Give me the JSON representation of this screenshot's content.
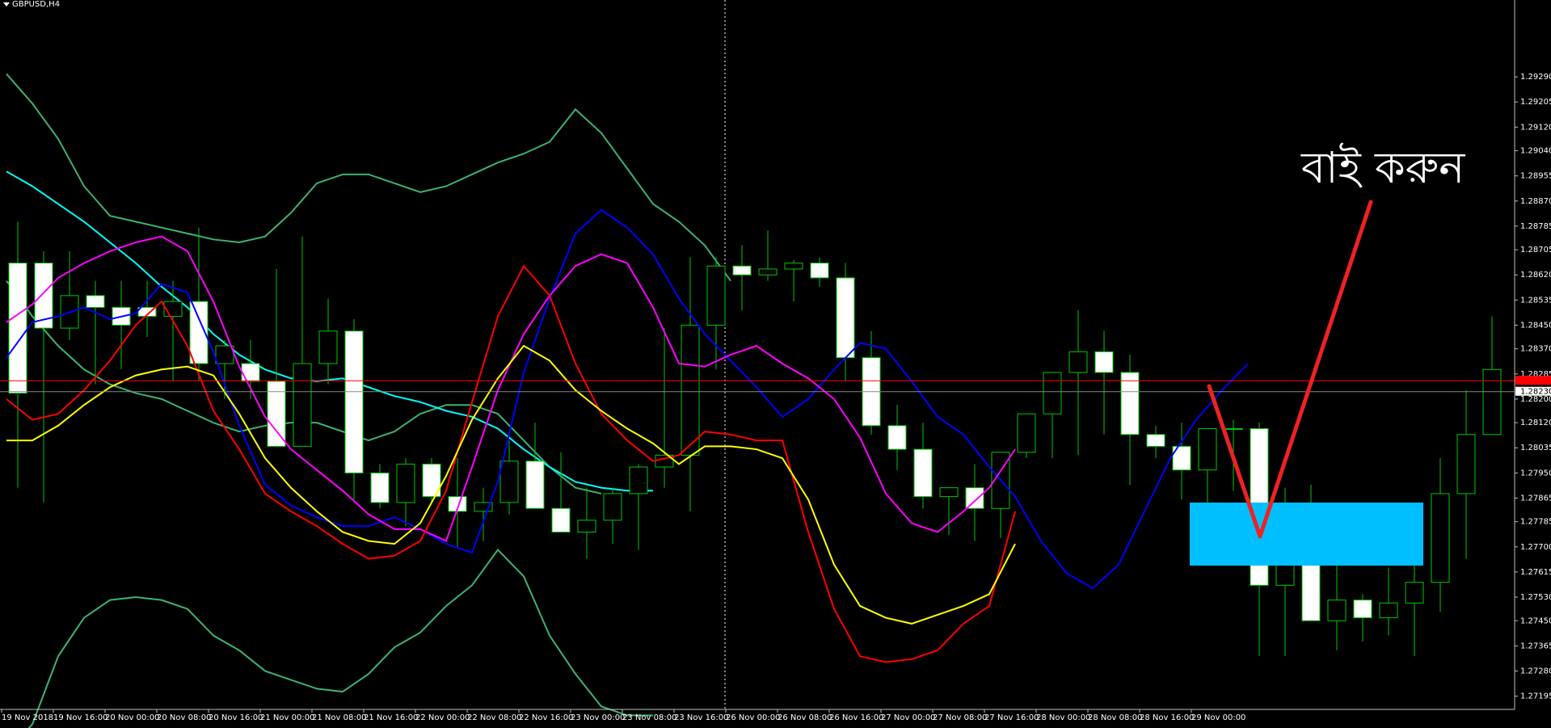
{
  "window": {
    "symbol": "GBPUSD,H4"
  },
  "annotation": {
    "text": "বাই করুন",
    "arrow_color": "#ee2222",
    "zone_color": "#00bfff"
  },
  "colors": {
    "background": "#000000",
    "candle_up": "#000000",
    "candle_down": "#ffffff",
    "candle_outline": "#00c800",
    "ma_blue": "#0000ff",
    "ma_magenta": "#ff00ff",
    "ma_red": "#ff0000",
    "ma_yellow": "#ffff00",
    "ma_cyan": "#00ffff",
    "bands": "#3cb371",
    "bid_line": "#ff0000",
    "bid_label_bg": "#ff0000",
    "current_label_bg": "#ffffff"
  },
  "chart_data": {
    "type": "candlestick",
    "symbol": "GBPUSD",
    "timeframe": "H4",
    "ylim": [
      1.2715,
      1.2955
    ],
    "price_ticks": [
      "1.29290",
      "1.29205",
      "1.29120",
      "1.29040",
      "1.28955",
      "1.28870",
      "1.28785",
      "1.28705",
      "1.28620",
      "1.28535",
      "1.28450",
      "1.28370",
      "1.28285",
      "1.28200",
      "1.28120",
      "1.28035",
      "1.27950",
      "1.27865",
      "1.27785",
      "1.27700",
      "1.27615",
      "1.27530",
      "1.27450",
      "1.27365",
      "1.27280",
      "1.27195"
    ],
    "current_price_label": "1.28230",
    "bid_line_price": 1.28262,
    "time_labels": [
      "19 Nov 2018",
      "19 Nov 16:00",
      "20 Nov 00:00",
      "20 Nov 08:00",
      "20 Nov 16:00",
      "21 Nov 00:00",
      "21 Nov 08:00",
      "21 Nov 16:00",
      "22 Nov 00:00",
      "22 Nov 08:00",
      "22 Nov 16:00",
      "23 Nov 00:00",
      "23 Nov 08:00",
      "23 Nov 16:00",
      "26 Nov 00:00",
      "26 Nov 08:00",
      "26 Nov 16:00",
      "27 Nov 00:00",
      "27 Nov 08:00",
      "27 Nov 16:00",
      "28 Nov 00:00",
      "28 Nov 08:00",
      "28 Nov 16:00",
      "29 Nov 00:00"
    ],
    "candles": [
      [
        1.2866,
        1.288,
        1.279,
        1.2822
      ],
      [
        1.2866,
        1.287,
        1.2785,
        1.2844
      ],
      [
        1.2844,
        1.287,
        1.284,
        1.2855
      ],
      [
        1.2855,
        1.286,
        1.2825,
        1.2851
      ],
      [
        1.2851,
        1.286,
        1.283,
        1.2845
      ],
      [
        1.2851,
        1.286,
        1.2841,
        1.2848
      ],
      [
        1.2848,
        1.286,
        1.2826,
        1.2853
      ],
      [
        1.2853,
        1.2878,
        1.2826,
        1.2832
      ],
      [
        1.2832,
        1.284,
        1.282,
        1.2838
      ],
      [
        1.2832,
        1.284,
        1.282,
        1.2826
      ],
      [
        1.2826,
        1.2864,
        1.2819,
        1.2804
      ],
      [
        1.2804,
        1.2875,
        1.2825,
        1.2832
      ],
      [
        1.2832,
        1.2854,
        1.2825,
        1.2843
      ],
      [
        1.2843,
        1.2847,
        1.2785,
        1.2795
      ],
      [
        1.2795,
        1.2798,
        1.2783,
        1.2785
      ],
      [
        1.2785,
        1.28,
        1.2777,
        1.2798
      ],
      [
        1.2798,
        1.28,
        1.2785,
        1.2787
      ],
      [
        1.2787,
        1.28,
        1.277,
        1.2782
      ],
      [
        1.2782,
        1.279,
        1.2772,
        1.2785
      ],
      [
        1.2785,
        1.2806,
        1.2781,
        1.2799
      ],
      [
        1.2799,
        1.2812,
        1.2793,
        1.2783
      ],
      [
        1.2783,
        1.2802,
        1.278,
        1.2775
      ],
      [
        1.2775,
        1.279,
        1.2766,
        1.2779
      ],
      [
        1.2779,
        1.279,
        1.2771,
        1.2788
      ],
      [
        1.2788,
        1.2798,
        1.2769,
        1.2797
      ],
      [
        1.2797,
        1.2844,
        1.279,
        1.2801
      ],
      [
        1.2801,
        1.2868,
        1.2782,
        1.2845
      ],
      [
        1.2845,
        1.2868,
        1.283,
        1.2865
      ],
      [
        1.2865,
        1.2872,
        1.285,
        1.2862
      ],
      [
        1.2862,
        1.2877,
        1.286,
        1.2864
      ],
      [
        1.2864,
        1.2867,
        1.2853,
        1.2866
      ],
      [
        1.2866,
        1.2868,
        1.2858,
        1.2861
      ],
      [
        1.2861,
        1.2866,
        1.2826,
        1.2834
      ],
      [
        1.2834,
        1.2843,
        1.2808,
        1.2811
      ],
      [
        1.2811,
        1.2818,
        1.2796,
        1.2803
      ],
      [
        1.2803,
        1.2812,
        1.2783,
        1.2787
      ],
      [
        1.2787,
        1.279,
        1.2774,
        1.279
      ],
      [
        1.279,
        1.2798,
        1.2772,
        1.2783
      ],
      [
        1.2783,
        1.2787,
        1.2773,
        1.2802
      ],
      [
        1.2802,
        1.2808,
        1.28,
        1.2815
      ],
      [
        1.2815,
        1.2826,
        1.28,
        1.2829
      ],
      [
        1.2829,
        1.285,
        1.2801,
        1.2836
      ],
      [
        1.2836,
        1.2843,
        1.2808,
        1.2829
      ],
      [
        1.2829,
        1.2835,
        1.2791,
        1.2808
      ],
      [
        1.2808,
        1.2811,
        1.28,
        1.2804
      ],
      [
        1.2804,
        1.2812,
        1.2786,
        1.2796
      ],
      [
        1.2796,
        1.2809,
        1.2785,
        1.281
      ],
      [
        1.281,
        1.2813,
        1.2789,
        1.281
      ],
      [
        1.281,
        1.2812,
        1.2733,
        1.2757
      ],
      [
        1.2757,
        1.279,
        1.2733,
        1.2781
      ],
      [
        1.2781,
        1.2791,
        1.2756,
        1.2745
      ],
      [
        1.2745,
        1.2766,
        1.2735,
        1.2752
      ],
      [
        1.2752,
        1.2754,
        1.2738,
        1.2746
      ],
      [
        1.2746,
        1.2763,
        1.274,
        1.2751
      ],
      [
        1.2751,
        1.2768,
        1.2733,
        1.2758
      ],
      [
        1.2758,
        1.28,
        1.2748,
        1.2788
      ],
      [
        1.2788,
        1.2823,
        1.2766,
        1.2808
      ],
      [
        1.2808,
        1.2848,
        1.2808,
        1.283
      ],
      [
        1.283,
        1.2845,
        1.2808,
        1.2836
      ],
      [
        1.2836,
        1.2841,
        1.2819,
        1.2832
      ]
    ],
    "ma_blue": [
      1.2834,
      1.2846,
      1.2848,
      1.2851,
      1.2847,
      1.2849,
      1.2859,
      1.2856,
      1.2836,
      1.2811,
      1.2791,
      1.2784,
      1.278,
      1.2777,
      1.2777,
      1.278,
      1.2776,
      1.2771,
      1.2768,
      1.2792,
      1.2829,
      1.2854,
      1.2876,
      1.2884,
      1.2878,
      1.2869,
      1.2854,
      1.2842,
      1.2833,
      1.2824,
      1.2814,
      1.282,
      1.283,
      1.2839,
      1.2837,
      1.2826,
      1.2814,
      1.2808,
      1.2797,
      1.2787,
      1.2772,
      1.2761,
      1.2756,
      1.2764,
      1.2782,
      1.28,
      1.2813,
      1.2823,
      1.2832
    ],
    "ma_magenta": [
      1.2846,
      1.2852,
      1.2861,
      1.2866,
      1.287,
      1.2873,
      1.2875,
      1.287,
      1.2853,
      1.2831,
      1.2814,
      1.2803,
      1.2796,
      1.2789,
      1.2781,
      1.2776,
      1.2776,
      1.2772,
      1.2797,
      1.2823,
      1.2842,
      1.2855,
      1.2865,
      1.2869,
      1.2866,
      1.2851,
      1.2832,
      1.2831,
      1.2835,
      1.2838,
      1.2832,
      1.2827,
      1.282,
      1.2807,
      1.2788,
      1.2778,
      1.2775,
      1.2782,
      1.279,
      1.2803
    ],
    "ma_red": [
      1.282,
      1.2813,
      1.2815,
      1.2823,
      1.2833,
      1.2845,
      1.2853,
      1.2838,
      1.2816,
      1.2803,
      1.2788,
      1.2782,
      1.2777,
      1.2771,
      1.2766,
      1.2767,
      1.2772,
      1.2789,
      1.2819,
      1.2848,
      1.2865,
      1.2855,
      1.2832,
      1.2815,
      1.2806,
      1.2799,
      1.2801,
      1.2809,
      1.2808,
      1.2806,
      1.2806,
      1.2775,
      1.2749,
      1.2733,
      1.2731,
      1.2732,
      1.2735,
      1.2744,
      1.275,
      1.2782
    ],
    "ma_yellow": [
      1.2806,
      1.2806,
      1.2811,
      1.2818,
      1.2824,
      1.2828,
      1.283,
      1.2831,
      1.2828,
      1.2815,
      1.28,
      1.279,
      1.2782,
      1.2775,
      1.2772,
      1.2771,
      1.2778,
      1.2794,
      1.2813,
      1.2827,
      1.2838,
      1.2833,
      1.2823,
      1.2816,
      1.281,
      1.2805,
      1.2798,
      1.2804,
      1.2804,
      1.2803,
      1.28,
      1.2786,
      1.2764,
      1.275,
      1.2746,
      1.2744,
      1.2747,
      1.275,
      1.2754,
      1.2771
    ],
    "ma_cyan": [
      1.2897,
      1.2892,
      1.2886,
      1.288,
      1.2873,
      1.2866,
      1.2858,
      1.2851,
      1.2842,
      1.2835,
      1.283,
      1.2827,
      1.2826,
      1.2827,
      1.2824,
      1.2821,
      1.2819,
      1.2816,
      1.2814,
      1.281,
      1.2803,
      1.2797,
      1.2792,
      1.279,
      1.2789,
      1.2789
    ],
    "band_upper": [
      1.293,
      1.292,
      1.2908,
      1.2892,
      1.2882,
      1.288,
      1.2878,
      1.2876,
      1.2874,
      1.2873,
      1.2875,
      1.2883,
      1.2893,
      1.2896,
      1.2896,
      1.2893,
      1.289,
      1.2892,
      1.2896,
      1.29,
      1.2903,
      1.2907,
      1.2918,
      1.291,
      1.2898,
      1.2886,
      1.288,
      1.2872,
      1.286
    ],
    "band_mid": [
      1.286,
      1.2848,
      1.2838,
      1.283,
      1.2825,
      1.2822,
      1.282,
      1.2816,
      1.2812,
      1.2809,
      1.2811,
      1.2812,
      1.2812,
      1.2809,
      1.2806,
      1.2809,
      1.2815,
      1.2818,
      1.2818,
      1.2815,
      1.2806,
      1.2797,
      1.279,
      1.2788
    ],
    "band_lower": [
      1.27,
      1.271,
      1.2733,
      1.2746,
      1.2752,
      1.2753,
      1.2752,
      1.2749,
      1.274,
      1.2735,
      1.2728,
      1.2725,
      1.2722,
      1.2721,
      1.2727,
      1.2736,
      1.2741,
      1.275,
      1.2757,
      1.2769,
      1.276,
      1.274,
      1.2727,
      1.2716,
      1.2713,
      1.2713
    ]
  }
}
